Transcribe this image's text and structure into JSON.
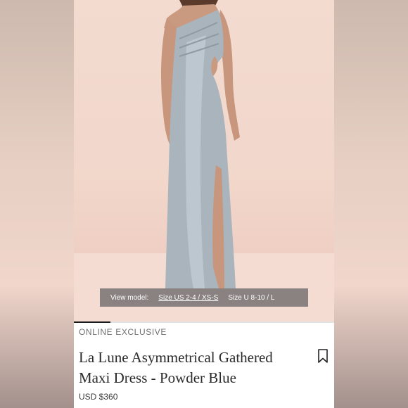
{
  "image": {
    "alt_subject": "model-wearing-dress-icon",
    "view_model_bar": {
      "label": "View model:",
      "size_options": [
        "Size US 2-4 / XS-S",
        "Size U 8-10 / L"
      ],
      "selected_index": 0
    }
  },
  "carousel": {
    "progress": 0.14
  },
  "product": {
    "badge": "ONLINE EXCLUSIVE",
    "title_line1": "La Lune Asymmetrical Gathered",
    "title_line2": "Maxi Dress - Powder Blue",
    "price": "USD $360",
    "bookmark_icon": "bookmark-icon"
  },
  "colors": {
    "dress": "#a9b4bd",
    "background": "#f2d7cb",
    "text": "#2a2a2a"
  }
}
